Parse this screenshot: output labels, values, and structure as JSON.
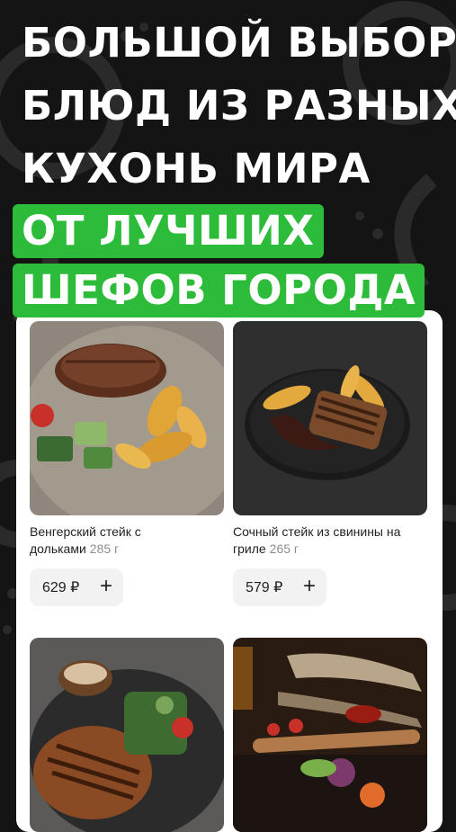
{
  "headline": {
    "line1": "БОЛЬШОЙ ВЫБОР",
    "line2": "БЛЮД ИЗ РАЗНЫХ",
    "line3": "КУХОНЬ МИРА",
    "highlight_line1": "ОТ ЛУЧШИХ",
    "highlight_line2": "ШЕФОВ ГОРОДА"
  },
  "colors": {
    "accent": "#2dbb3a",
    "background": "#141414"
  },
  "dishes": [
    {
      "name": "Венгерский стейк с дольками",
      "weight": "285 г",
      "price": "629 ₽",
      "add_icon": "plus-icon"
    },
    {
      "name": "Сочный стейк из свинины на гриле",
      "weight": "265 г",
      "price": "579 ₽",
      "add_icon": "plus-icon"
    },
    {
      "name": "",
      "weight": "",
      "price": "",
      "add_icon": ""
    },
    {
      "name": "",
      "weight": "",
      "price": "",
      "add_icon": ""
    }
  ]
}
